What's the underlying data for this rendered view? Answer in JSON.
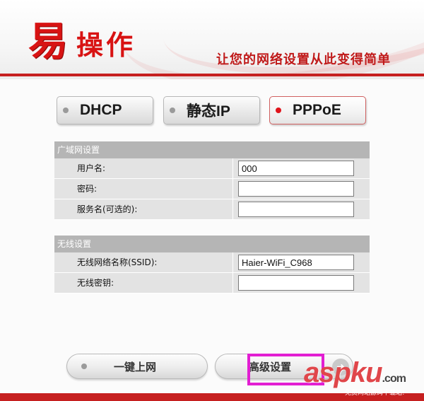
{
  "header": {
    "logo_char": "易",
    "logo_rest": "操作",
    "slogan": "让您的网络设置从此变得简单"
  },
  "modes": [
    {
      "label": "DHCP",
      "active": false
    },
    {
      "label": "静态IP",
      "active": false
    },
    {
      "label": "PPPoE",
      "active": true
    }
  ],
  "wan": {
    "heading": "广域网设置",
    "username_label": "用户名:",
    "username_value": "000",
    "password_label": "密码:",
    "password_value": "",
    "service_label": "服务名(可选的):",
    "service_value": ""
  },
  "wireless": {
    "heading": "无线设置",
    "ssid_label": "无线网络名称(SSID):",
    "ssid_value": "Haier-WiFi_C968",
    "key_label": "无线密钥:",
    "key_value": ""
  },
  "actions": {
    "connect_label": "一键上网",
    "advanced_label": "高级设置"
  },
  "watermark": {
    "main": "aspku",
    "suffix": ".com",
    "sub": "免费网站源码下载站!"
  },
  "colors": {
    "accent": "#d81313",
    "active_dot": "#e0141b",
    "highlight": "#e21ed2",
    "section_header": "#b5b5b5",
    "row_bg": "#e3e3e3"
  }
}
